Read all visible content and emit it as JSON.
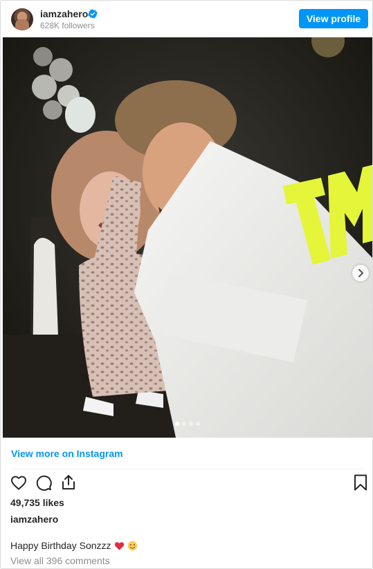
{
  "header": {
    "username": "iamzahero",
    "followers": "628K followers",
    "view_profile_label": "View profile"
  },
  "post": {
    "carousel_dots": 4,
    "carousel_active_index": 0,
    "view_more_label": "View more on Instagram",
    "likes": "49,735 likes",
    "author": "iamzahero",
    "caption": "Happy Birthday Sonzzz",
    "caption_emojis": [
      "red-heart-emoji",
      "smiling-face-emoji"
    ],
    "comments_link": "View all 396 comments"
  },
  "icons": {
    "verified": "verified-badge-icon",
    "like": "heart-icon",
    "comment": "comment-icon",
    "share": "share-icon",
    "save": "bookmark-icon",
    "next": "chevron-right-icon"
  },
  "colors": {
    "accent": "#0095f6",
    "text": "#262626",
    "muted": "#8e8e8e",
    "neon": "#e4f53a"
  }
}
